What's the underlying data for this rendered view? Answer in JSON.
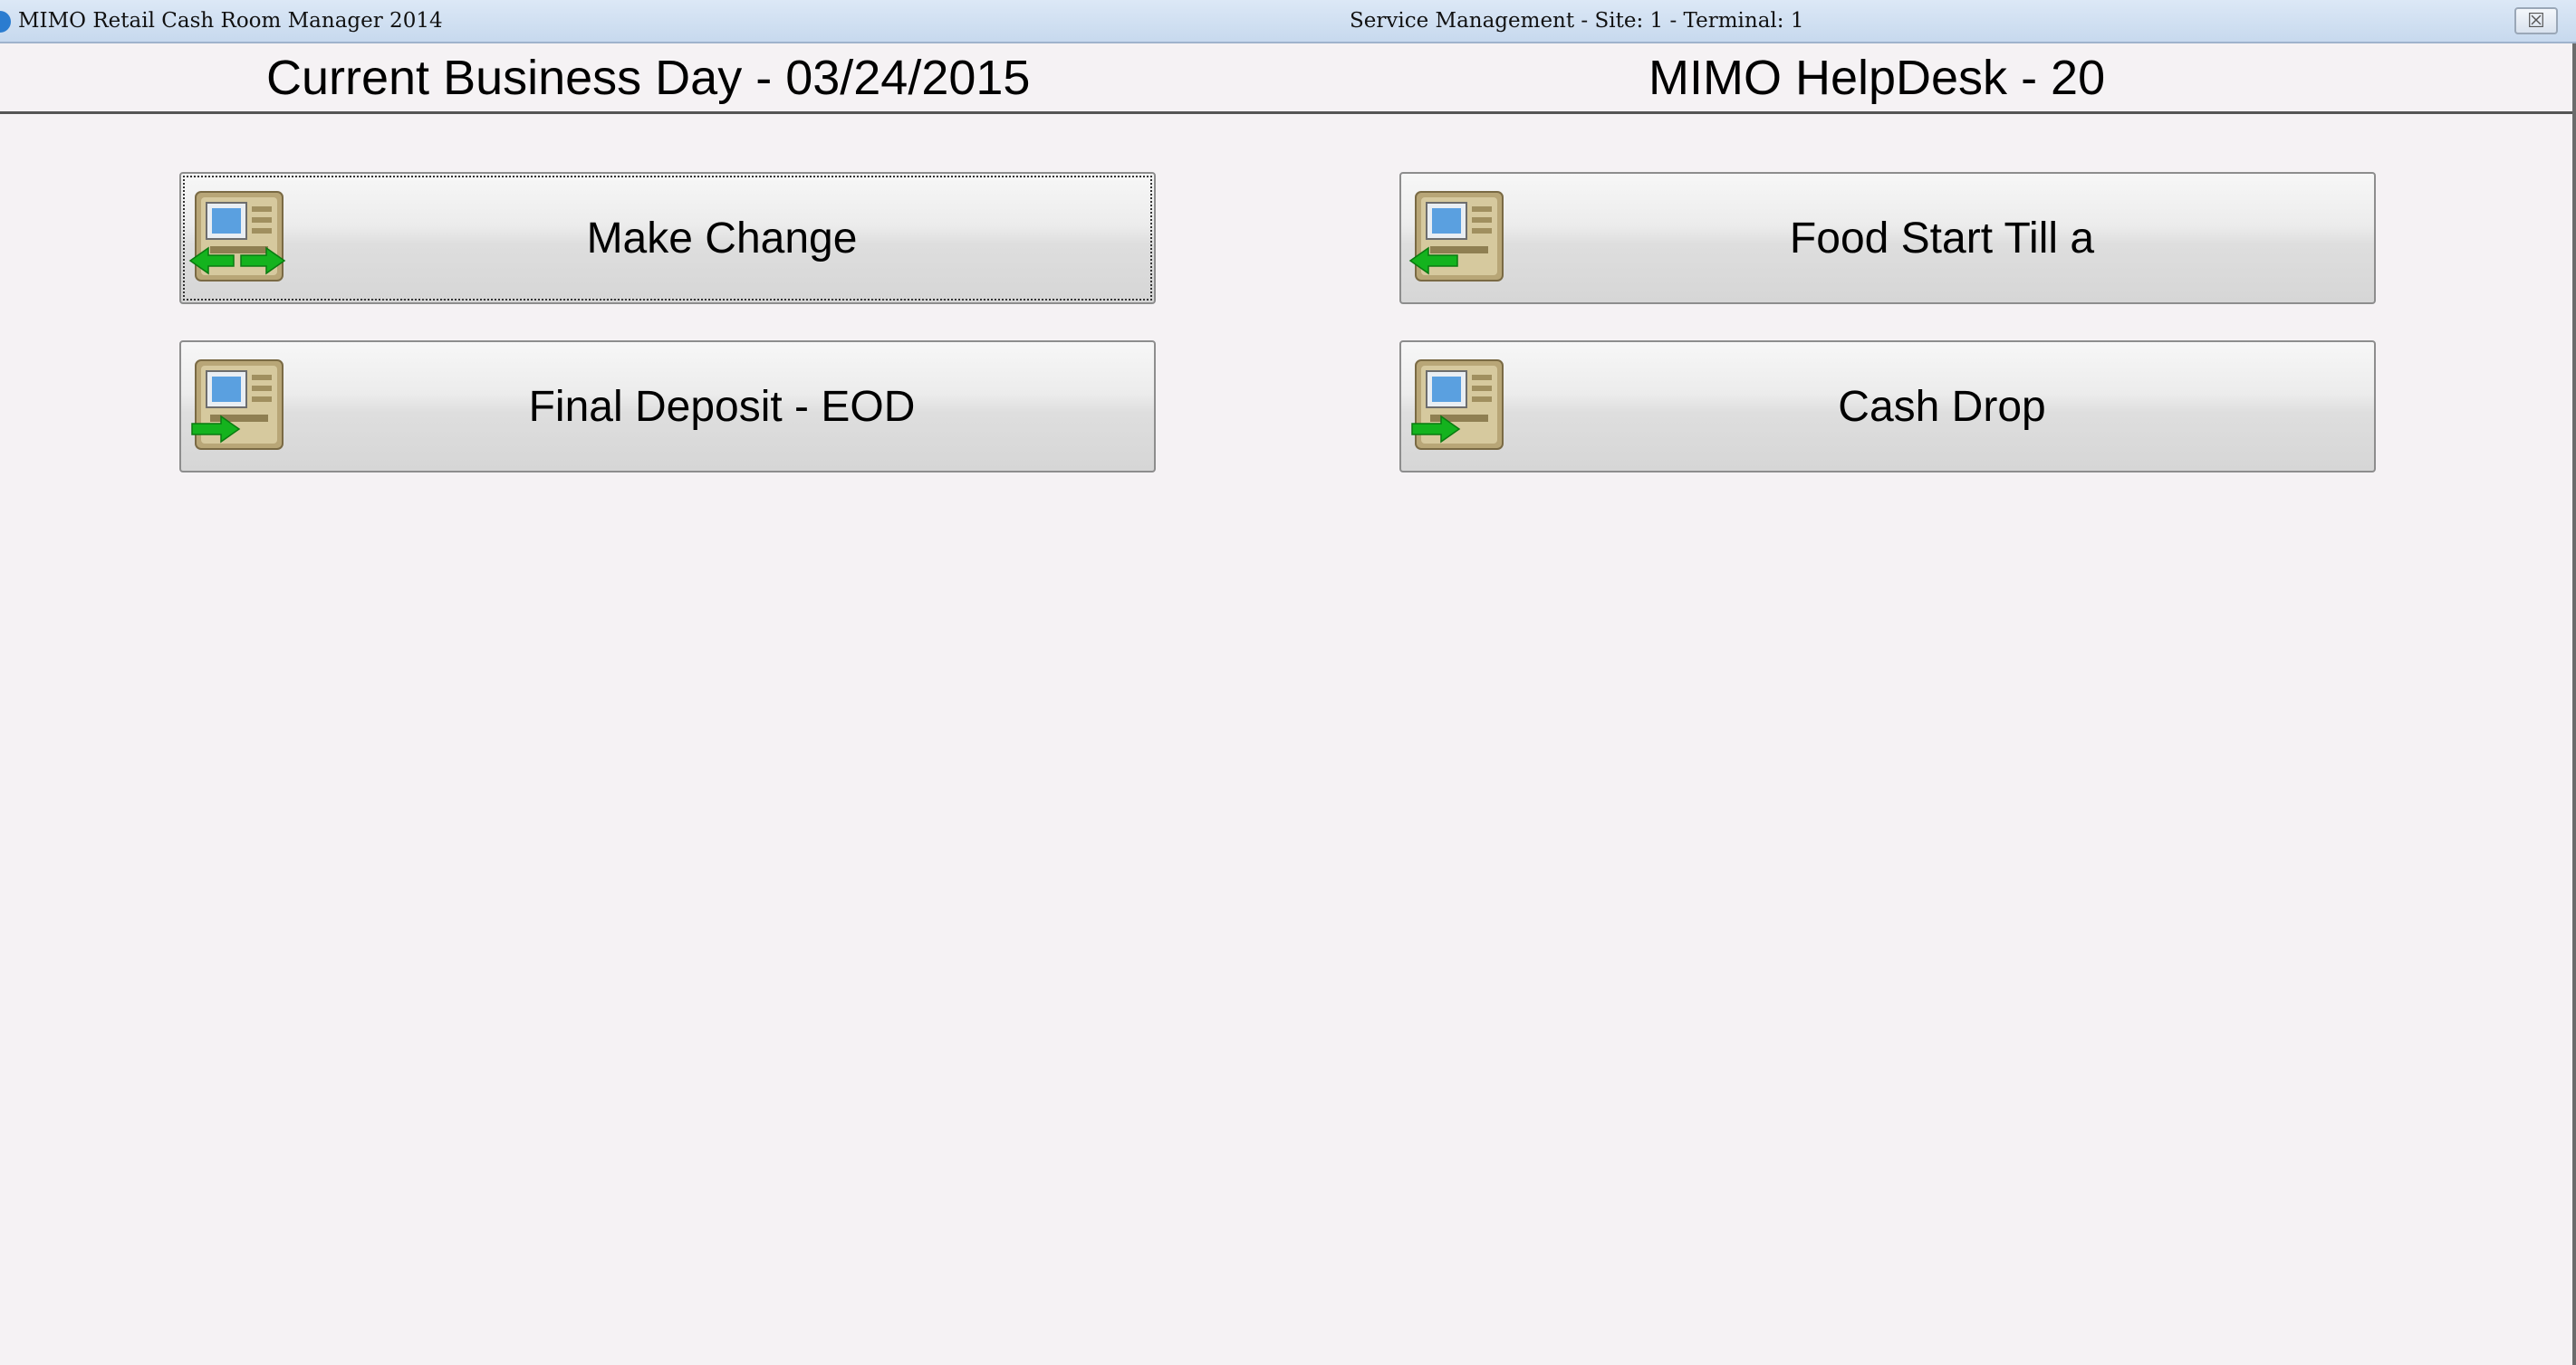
{
  "titlebar": {
    "app_title": "MIMO Retail Cash Room Manager 2014",
    "window_title": "Service Management - Site: 1 - Terminal: 1",
    "close_glyph": "☒"
  },
  "header": {
    "business_day": "Current Business Day - 03/24/2015",
    "helpdesk": "MIMO HelpDesk - 20"
  },
  "actions": [
    {
      "label": "Make Change",
      "icon": "atm-exchange-icon"
    },
    {
      "label": "Food Start Till a",
      "icon": "atm-withdraw-icon"
    },
    {
      "label": "Final Deposit - EOD",
      "icon": "atm-deposit-icon"
    },
    {
      "label": "Cash Drop",
      "icon": "atm-deposit-icon"
    }
  ],
  "colors": {
    "background": "#f5f2f4",
    "arrow_green": "#14b31e",
    "atm_body": "#c9b98a",
    "atm_screen": "#5aa0e0"
  }
}
